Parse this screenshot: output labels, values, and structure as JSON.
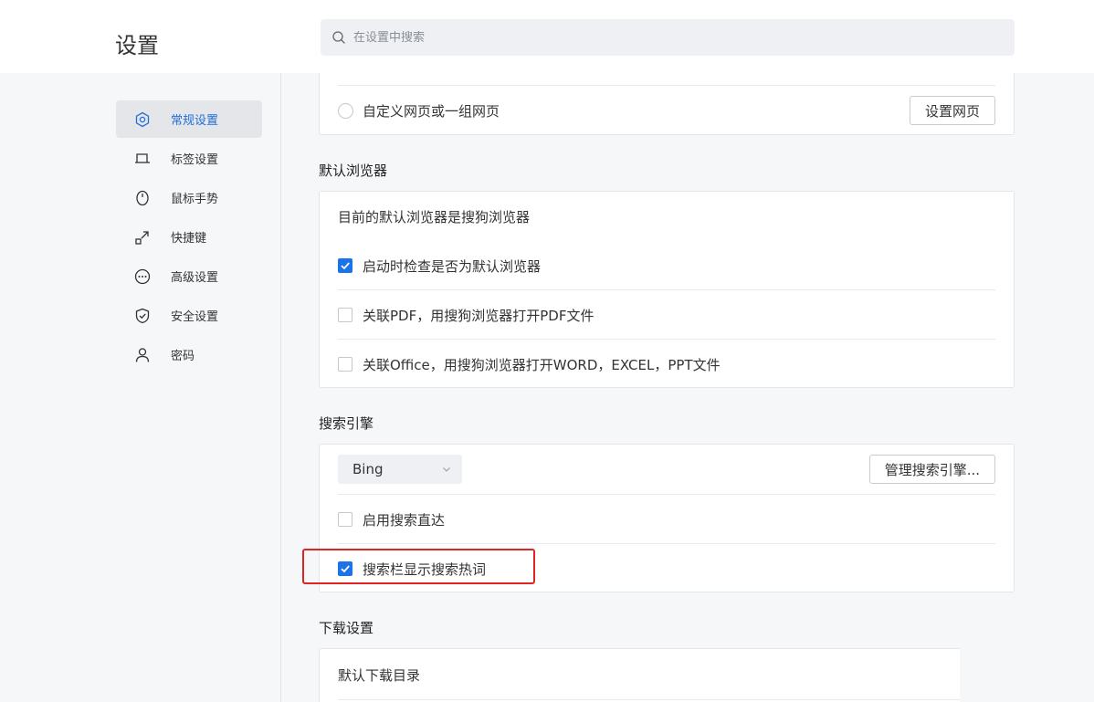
{
  "header": {
    "title": "设置",
    "search_placeholder": "在设置中搜索"
  },
  "sidebar": {
    "items": [
      {
        "label": "常规设置",
        "icon": "hexagon-settings-icon",
        "active": true
      },
      {
        "label": "标签设置",
        "icon": "tab-icon",
        "active": false
      },
      {
        "label": "鼠标手势",
        "icon": "mouse-icon",
        "active": false
      },
      {
        "label": "快捷键",
        "icon": "shortcut-arrow-icon",
        "active": false
      },
      {
        "label": "高级设置",
        "icon": "more-dots-icon",
        "active": false
      },
      {
        "label": "安全设置",
        "icon": "shield-check-icon",
        "active": false
      },
      {
        "label": "密码",
        "icon": "user-icon",
        "active": false
      }
    ]
  },
  "startup": {
    "custom_pages_label": "自定义网页或一组网页",
    "set_pages_button": "设置网页"
  },
  "default_browser": {
    "section_title": "默认浏览器",
    "status_text": "目前的默认浏览器是搜狗浏览器",
    "check_on_startup_label": "启动时检查是否为默认浏览器",
    "check_on_startup_checked": true,
    "associate_pdf_label": "关联PDF，用搜狗浏览器打开PDF文件",
    "associate_pdf_checked": false,
    "associate_office_label": "关联Office，用搜狗浏览器打开WORD，EXCEL，PPT文件",
    "associate_office_checked": false
  },
  "search_engine": {
    "section_title": "搜索引擎",
    "selected_engine": "Bing",
    "manage_button": "管理搜索引擎...",
    "direct_search_label": "启用搜索直达",
    "direct_search_checked": false,
    "show_hot_words_label": "搜索栏显示搜索热词",
    "show_hot_words_checked": true
  },
  "download": {
    "section_title": "下载设置",
    "default_dir_label": "默认下载目录"
  },
  "colors": {
    "accent": "#1a73e8",
    "highlight": "#e02424"
  }
}
